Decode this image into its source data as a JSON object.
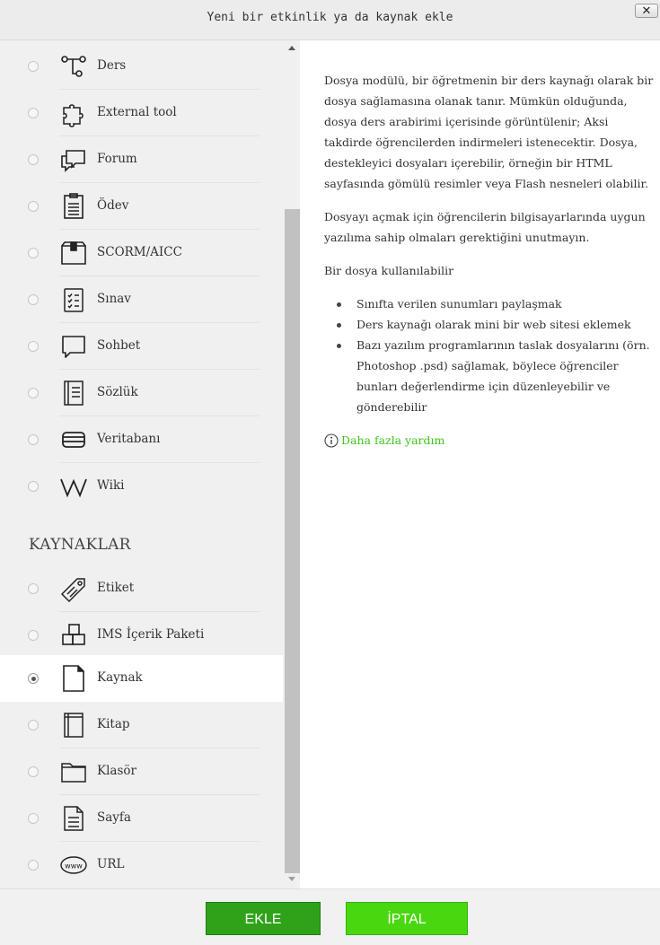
{
  "dialog": {
    "title": "Yeni bir etkinlik ya da kaynak ekle",
    "close_label": "✕"
  },
  "activities": [
    {
      "label": "Ders",
      "icon": "lesson-icon"
    },
    {
      "label": "External tool",
      "icon": "puzzle-icon"
    },
    {
      "label": "Forum",
      "icon": "forum-icon"
    },
    {
      "label": "Ödev",
      "icon": "assignment-icon"
    },
    {
      "label": "SCORM/AICC",
      "icon": "scorm-icon"
    },
    {
      "label": "Sınav",
      "icon": "quiz-icon"
    },
    {
      "label": "Sohbet",
      "icon": "chat-icon"
    },
    {
      "label": "Sözlük",
      "icon": "glossary-icon"
    },
    {
      "label": "Veritabanı",
      "icon": "database-icon"
    },
    {
      "label": "Wiki",
      "icon": "wiki-icon"
    }
  ],
  "resources_heading": "KAYNAKLAR",
  "resources": [
    {
      "label": "Etiket",
      "icon": "label-tag-icon"
    },
    {
      "label": "IMS İçerik Paketi",
      "icon": "ims-package-icon"
    },
    {
      "label": "Kaynak",
      "icon": "file-icon",
      "selected": true
    },
    {
      "label": "Kitap",
      "icon": "book-icon"
    },
    {
      "label": "Klasör",
      "icon": "folder-icon"
    },
    {
      "label": "Sayfa",
      "icon": "page-icon"
    },
    {
      "label": "URL",
      "icon": "url-icon"
    }
  ],
  "description": {
    "paragraphs": [
      "Dosya modülü, bir öğretmenin bir ders kaynağı olarak bir dosya sağlamasına olanak tanır. Mümkün olduğunda, dosya ders arabirimi içerisinde görüntülenir; Aksi takdirde öğrencilerden indirmeleri istenecektir. Dosya, destekleyici dosyaları içerebilir, örneğin bir HTML sayfasında gömülü resimler veya Flash nesneleri olabilir.",
      "Dosyayı açmak için öğrencilerin bilgisayarlarında uygun yazılıma sahip olmaları gerektiğini unutmayın.",
      "Bir dosya kullanılabilir"
    ],
    "bullets": [
      "Sınıfta verilen sunumları paylaşmak",
      "Ders kaynağı olarak mini bir web sitesi eklemek",
      "Bazı yazılım programlarının taslak dosyalarını (örn. Photoshop .psd) sağlamak, böylece öğrenciler bunları değerlendirme için düzenleyebilir ve gönderebilir"
    ],
    "help_link": "Daha fazla yardım"
  },
  "footer": {
    "add_label": "EKLE",
    "cancel_label": "İPTAL"
  },
  "colors": {
    "add_button": "#2fa21a",
    "cancel_button": "#49d80f",
    "link": "#3fc41a",
    "panel_bg": "#f0f0f0"
  }
}
